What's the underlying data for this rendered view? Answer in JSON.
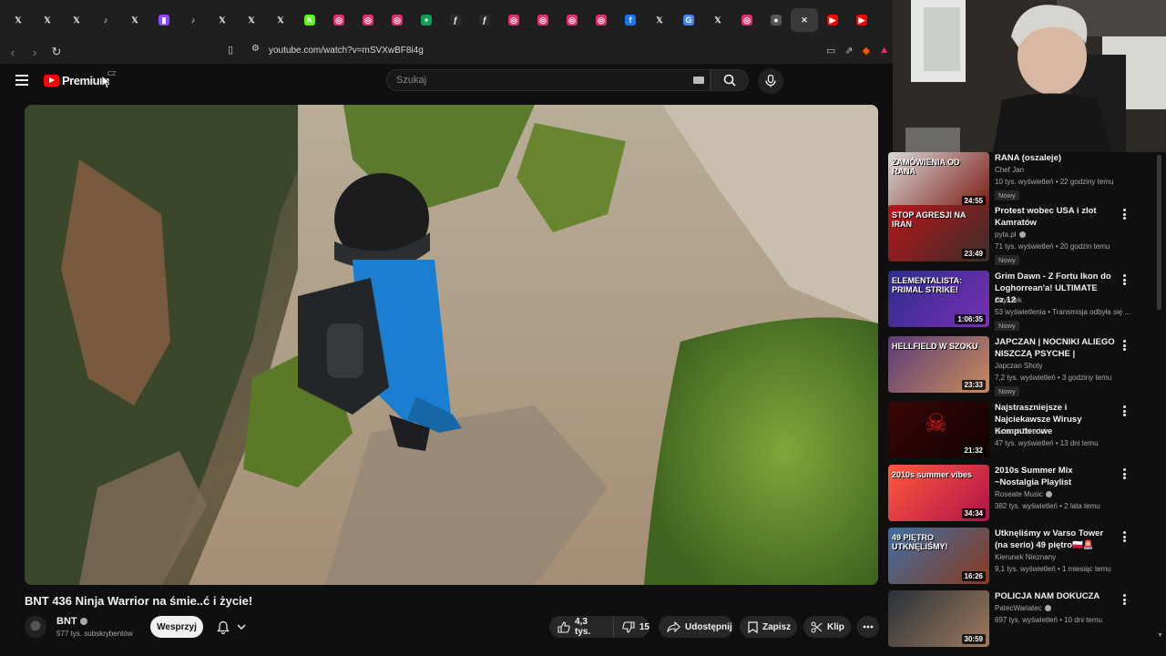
{
  "browser": {
    "tabs": [
      {
        "icon": "x-icon",
        "glyph": "𝕏",
        "color": "#000000"
      },
      {
        "icon": "x-icon",
        "glyph": "𝕏",
        "color": "#000000"
      },
      {
        "icon": "x-icon",
        "glyph": "𝕏",
        "color": "#000000"
      },
      {
        "icon": "tiktok-icon",
        "glyph": "♪",
        "color": "#000000"
      },
      {
        "icon": "x-icon",
        "glyph": "𝕏",
        "color": "#000000"
      },
      {
        "icon": "twitch-icon",
        "glyph": "▮",
        "color": "#9146ff"
      },
      {
        "icon": "tiktok-icon",
        "glyph": "♪",
        "color": "#000000"
      },
      {
        "icon": "x-icon",
        "glyph": "𝕏",
        "color": "#000000"
      },
      {
        "icon": "x-icon",
        "glyph": "𝕏",
        "color": "#000000"
      },
      {
        "icon": "x-icon",
        "glyph": "𝕏",
        "color": "#000000"
      },
      {
        "icon": "kick-icon",
        "glyph": "K",
        "color": "#53fc18"
      },
      {
        "icon": "instagram-icon",
        "glyph": "◎",
        "color": "#e1306c"
      },
      {
        "icon": "instagram-icon",
        "glyph": "◎",
        "color": "#e1306c"
      },
      {
        "icon": "instagram-icon",
        "glyph": "◎",
        "color": "#e1306c"
      },
      {
        "icon": "sheets-icon",
        "glyph": "+",
        "color": "#0f9d58"
      },
      {
        "icon": "script-icon",
        "glyph": "ƒ",
        "color": "#2b2b2b"
      },
      {
        "icon": "script-icon",
        "glyph": "ƒ",
        "color": "#2b2b2b"
      },
      {
        "icon": "instagram-icon",
        "glyph": "◎",
        "color": "#e1306c"
      },
      {
        "icon": "instagram-icon",
        "glyph": "◎",
        "color": "#e1306c"
      },
      {
        "icon": "instagram-icon",
        "glyph": "◎",
        "color": "#e1306c"
      },
      {
        "icon": "instagram-icon",
        "glyph": "◎",
        "color": "#e1306c"
      },
      {
        "icon": "facebook-icon",
        "glyph": "f",
        "color": "#1877f2"
      },
      {
        "icon": "x-icon",
        "glyph": "𝕏",
        "color": "#000000"
      },
      {
        "icon": "google-icon",
        "glyph": "G",
        "color": "#4285f4"
      },
      {
        "icon": "x-icon",
        "glyph": "𝕏",
        "color": "#000000"
      },
      {
        "icon": "instagram-icon",
        "glyph": "◎",
        "color": "#e1306c"
      },
      {
        "icon": "github-icon",
        "glyph": "●",
        "color": "#555555"
      },
      {
        "icon": "close-icon",
        "glyph": "✕",
        "color": "#3a3a3a"
      },
      {
        "icon": "youtube-icon",
        "glyph": "▶",
        "color": "#ff0000"
      },
      {
        "icon": "youtube-icon",
        "glyph": "▶",
        "color": "#ff0000"
      }
    ],
    "url": "youtube.com/watch?v=mSVXwBF8i4g"
  },
  "header": {
    "logo_text": "Premium",
    "logo_region": "CZ",
    "search_placeholder": "Szukaj"
  },
  "video": {
    "title": "BNT 436 Ninja Warrior na śmie..ć i życie!",
    "channel": "BNT",
    "subscribers": "577 tys. subskrybentów",
    "support_label": "Wesprzyj",
    "likes": "4,3 tys.",
    "dislikes": "15",
    "share_label": "Udostępnij",
    "save_label": "Zapisz",
    "clip_label": "Klip"
  },
  "sidebar": {
    "items": [
      {
        "title": "RANA (oszaleje)",
        "channel": "Chef Jan",
        "meta": "10 tys. wyświetleń • 22 godziny temu",
        "badge": "Nowy",
        "duration": "24:55",
        "thumb_text": "ZAMÓWIENIA OD RANA",
        "thumb_colors": [
          "#d8d8d8",
          "#7a1a10"
        ]
      },
      {
        "title": "Protest wobec USA i zlot Kamratów",
        "channel": "pyta.pl",
        "verified": true,
        "meta": "71 tys. wyświetleń • 20 godzin temu",
        "badge": "Nowy",
        "duration": "23:49",
        "thumb_text": "STOP AGRESJI NA IRAN",
        "thumb_colors": [
          "#b8151b",
          "#3a2e28"
        ]
      },
      {
        "title": "Grim Dawn - Z Fortu Ikon do Loghorrean'a! ULTIMATE cz.12",
        "channel": "Zbyszek",
        "meta": "53 wyświetlenia • Transmisja odbyła się ...",
        "badge": "Nowy",
        "duration": "1:06:35",
        "thumb_text": "ELEMENTALISTA: PRIMAL STRIKE!",
        "thumb_colors": [
          "#2a2e8f",
          "#7b2fb0"
        ]
      },
      {
        "title": "JAPCZAN | NOCNIKI ALIEGO NISZCZĄ PSYCHE |",
        "channel": "Japczan Shoty",
        "meta": "7,2 tys. wyświetleń • 3 godziny temu",
        "badge": "Nowy",
        "duration": "23:33",
        "thumb_text": "HELLFIELD W SZOKU",
        "thumb_colors": [
          "#5a3b7a",
          "#c98b5a"
        ]
      },
      {
        "title": "Najstraszniejsze i Najciekawsze Wirusy Komputerowe",
        "channel": "Oczami Zbrodni",
        "meta": "47 tys. wyświetleń • 13 dni temu",
        "badge": "",
        "duration": "21:32",
        "thumb_text": "",
        "thumb_colors": [
          "#3a0606",
          "#120202"
        ]
      },
      {
        "title": "2010s Summer Mix ~Nostalgia Playlist",
        "channel": "Roseate Music",
        "verified": true,
        "meta": "382 tys. wyświetleń • 2 lata temu",
        "badge": "",
        "duration": "34:34",
        "thumb_text": "2010s summer vibes",
        "thumb_colors": [
          "#ff5a3c",
          "#b0124a"
        ]
      },
      {
        "title": "Utknęliśmy w Varso Tower (na serio) 49 piętro🇵🇱🚨",
        "channel": "Kierunek Nieznany",
        "meta": "9,1 tys. wyświetleń • 1 miesiąc temu",
        "badge": "",
        "duration": "16:26",
        "thumb_text": "49 PIĘTRO UTKNĘLIŚMY!",
        "thumb_colors": [
          "#3e6fa3",
          "#8a3a1f"
        ]
      },
      {
        "title": "POLICJA NAM DOKUCZA",
        "channel": "PatecWariatec",
        "verified": true,
        "meta": "697 tys. wyświetleń • 10 dni temu",
        "badge": "",
        "duration": "30:59",
        "thumb_text": "",
        "thumb_colors": [
          "#28313a",
          "#a07a5a"
        ]
      }
    ]
  }
}
